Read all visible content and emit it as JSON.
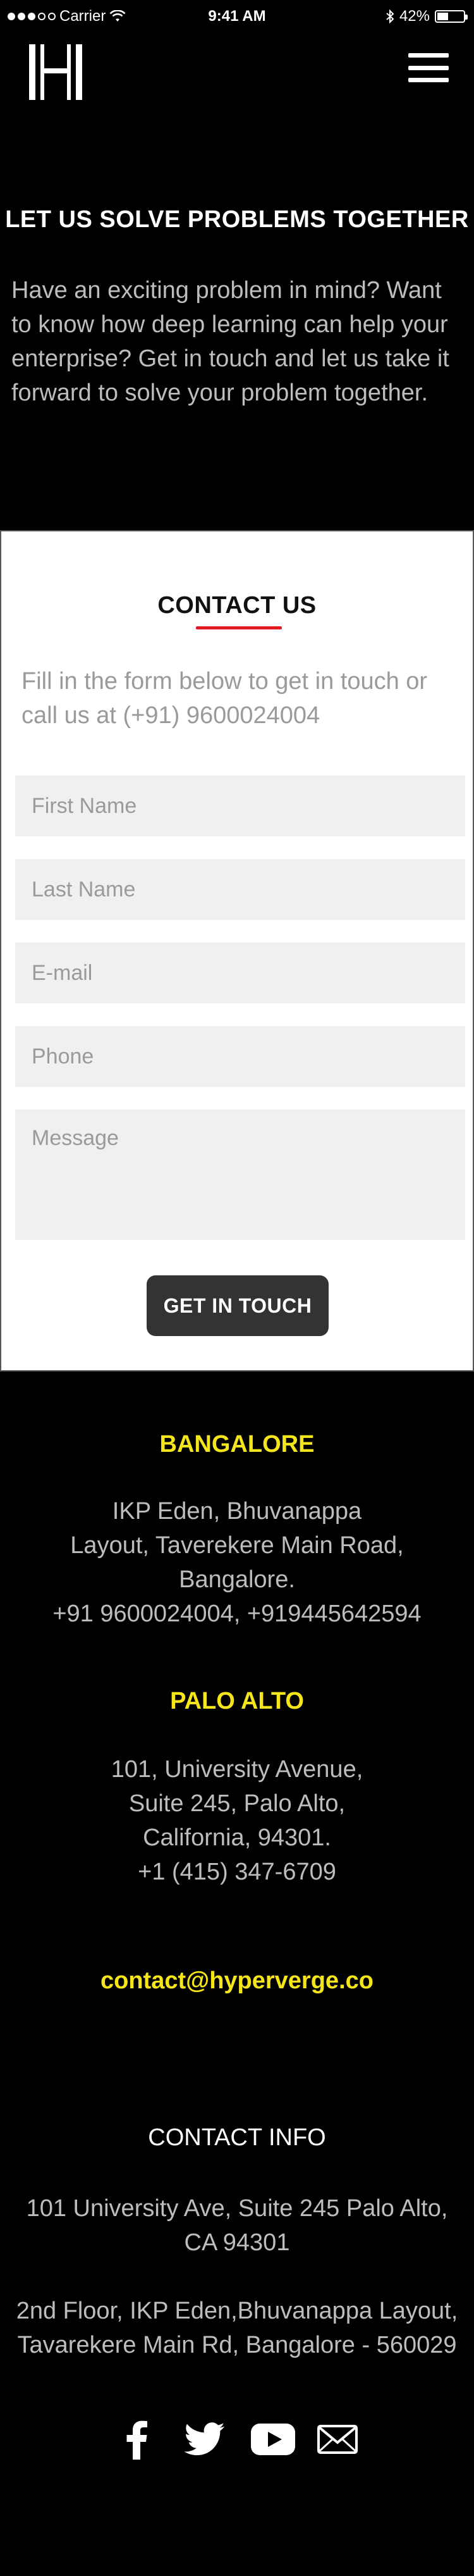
{
  "status_bar": {
    "carrier": "Carrier",
    "time": "9:41 AM",
    "battery_text": "42%",
    "battery_level": 0.42,
    "signal_bars_filled": 3,
    "signal_bars_total": 5
  },
  "header": {
    "logo_icon": "hyperverge-logo-icon",
    "menu_icon": "hamburger-menu-icon"
  },
  "hero": {
    "title": "LET US SOLVE PROBLEMS TOGETHER",
    "text": "Have an exciting problem in mind? Want to know how deep learning can help your enterprise? Get in touch and let us take it forward to solve your problem together."
  },
  "contact": {
    "title": "CONTACT US",
    "text": "Fill in the form below to get in touch or call us at (+91) 9600024004",
    "fields": {
      "first_name": "First Name",
      "last_name": "Last Name",
      "email": "E-mail",
      "phone": "Phone",
      "message": "Message"
    },
    "submit_label": "GET IN TOUCH",
    "accent_color": "#e31b23"
  },
  "offices": [
    {
      "city": "BANGALORE",
      "address_lines": [
        "IKP Eden, Bhuvanappa",
        "Layout, Taverekere Main Road,",
        "Bangalore.",
        "+91 9600024004, +919445642594"
      ]
    },
    {
      "city": "PALO ALTO",
      "address_lines": [
        "101, University Avenue,",
        "Suite 245, Palo Alto,",
        "California, 94301.",
        "+1 (415) 347-6709"
      ]
    }
  ],
  "email": "contact@hyperverge.co",
  "contact_info": {
    "title": "CONTACT INFO",
    "lines": [
      "101 University Ave, Suite 245 Palo Alto, CA 94301",
      "2nd Floor, IKP Eden,Bhuvanappa Layout, Tavarekere Main Rd, Bangalore - 560029"
    ]
  },
  "social": [
    "facebook-icon",
    "twitter-icon",
    "youtube-icon",
    "email-icon"
  ],
  "colors": {
    "background": "#000000",
    "highlight": "#f5e51b",
    "muted_text": "#bdbdbd",
    "button": "#333333"
  }
}
